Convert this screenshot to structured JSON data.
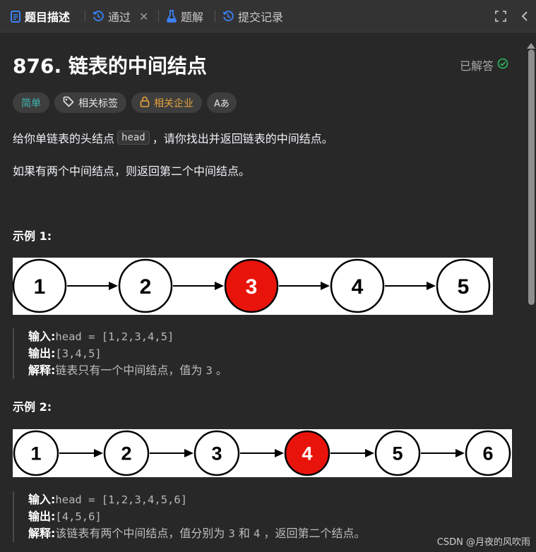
{
  "tabs": [
    {
      "label": "题目描述",
      "icon": "description-icon"
    },
    {
      "label": "通过",
      "icon": "history-icon"
    },
    {
      "label": "题解",
      "icon": "flask-icon"
    },
    {
      "label": "提交记录",
      "icon": "history-icon"
    }
  ],
  "problem": {
    "title": "876. 链表的中间结点",
    "status": "已解答",
    "tags": {
      "difficulty": "简单",
      "related_tags": "相关标签",
      "related_companies": "相关企业",
      "font_toggle": "Aあ"
    },
    "description_pre": "给你单链表的头结点",
    "description_code": "head",
    "description_post": "，请你找出并返回链表的中间结点。",
    "description_2": "如果有两个中间结点，则返回第二个中间结点。"
  },
  "examples": [
    {
      "title": "示例 1:",
      "nodes": [
        "1",
        "2",
        "3",
        "4",
        "5"
      ],
      "highlight": "3",
      "input_label": "输入:",
      "input": "head = [1,2,3,4,5]",
      "output_label": "输出:",
      "output": "[3,4,5]",
      "explain_label": "解释:",
      "explain": [
        {
          "t": "链表只有一个中间结点，值为 ",
          "mono": false
        },
        {
          "t": "3",
          "mono": true
        },
        {
          "t": " 。",
          "mono": false
        }
      ]
    },
    {
      "title": "示例 2:",
      "nodes": [
        "1",
        "2",
        "3",
        "4",
        "5",
        "6"
      ],
      "highlight": "4",
      "input_label": "输入:",
      "input": "head = [1,2,3,4,5,6]",
      "output_label": "输出:",
      "output": "[4,5,6]",
      "explain_label": "解释:",
      "explain": [
        {
          "t": "该链表有两个中间结点，值分别为 ",
          "mono": false
        },
        {
          "t": "3",
          "mono": true
        },
        {
          "t": " 和 ",
          "mono": false
        },
        {
          "t": "4",
          "mono": true
        },
        {
          "t": " ，返回第二个结点。",
          "mono": false
        }
      ]
    }
  ],
  "watermark": "CSDN @月夜的风吹雨",
  "colors": {
    "background": "#282828",
    "tabbar": "#333333",
    "easy": "#3fb6b1",
    "company": "#e7a33c",
    "solved_check": "#2cbb5d",
    "node_highlight": "#e8140c"
  }
}
